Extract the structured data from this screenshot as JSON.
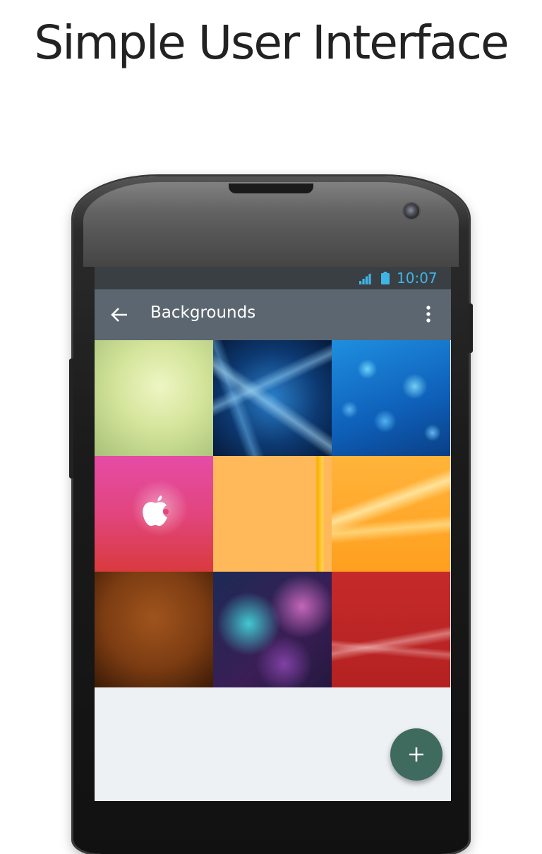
{
  "headline": "Simple User Interface",
  "status_bar": {
    "time": "10:07",
    "signal_icon": "signal-icon",
    "battery_icon": "battery-icon",
    "accent_color": "#3fb5e6"
  },
  "app_bar": {
    "title": "Backgrounds",
    "back_icon": "arrow-back-icon",
    "menu_icon": "more-vert-icon",
    "color": "#5b6670"
  },
  "wallpapers": [
    {
      "name": "green-texture"
    },
    {
      "name": "blue-fractal"
    },
    {
      "name": "blue-bokeh"
    },
    {
      "name": "pink-apple-sparkle"
    },
    {
      "name": "orange-solid"
    },
    {
      "name": "orange-waves"
    },
    {
      "name": "brown-pattern"
    },
    {
      "name": "colorful-stars"
    },
    {
      "name": "red-waves"
    }
  ],
  "fab": {
    "icon": "plus-icon",
    "color": "#3f6b5e"
  }
}
